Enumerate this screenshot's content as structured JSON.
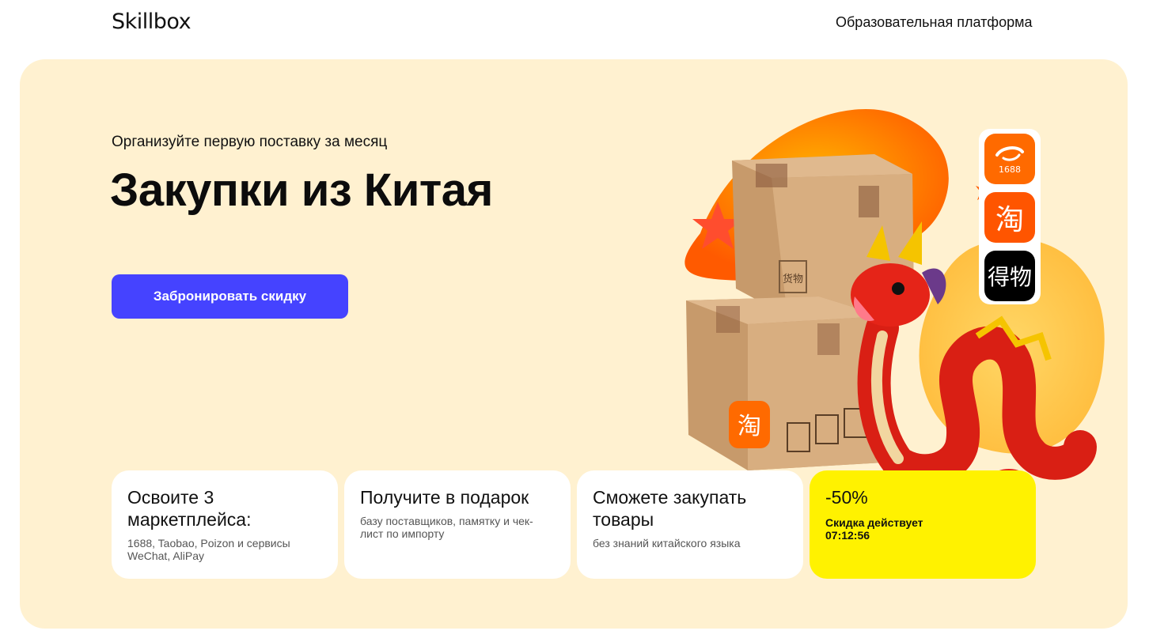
{
  "header": {
    "logo": "Skillbox",
    "platform_label": "Образовательная платформа"
  },
  "hero": {
    "subtitle": "Организуйте первую поставку за месяц",
    "title": "Закупки из Китая",
    "cta_label": "Забронировать скидку"
  },
  "illustration": {
    "box_stamp": "货物",
    "box_logo": "淘",
    "icons": [
      "parcel-cardboard-boxes",
      "dragon",
      "star"
    ]
  },
  "apps": [
    {
      "name": "1688-icon",
      "label": "1688"
    },
    {
      "name": "taobao-icon",
      "label": "淘"
    },
    {
      "name": "poizon-icon",
      "label": "得物"
    }
  ],
  "cards": [
    {
      "title": "Освоите 3 маркетплейса:",
      "text": "1688, Taobao, Poizon и сервисы WeChat, AliPay"
    },
    {
      "title": "Получите в подарок",
      "text": "базу поставщиков, памятку и чек-лист по импорту"
    },
    {
      "title": "Сможете закупать товары",
      "text": "без знаний китайского языка"
    },
    {
      "title": "-50%",
      "text": "Скидка  действует",
      "timer": "07:12:56"
    }
  ],
  "colors": {
    "hero_bg": "#fff1d0",
    "cta_bg": "#4543ff",
    "discount_card_bg": "#fff200",
    "orange_accent": "#ff6a00"
  }
}
